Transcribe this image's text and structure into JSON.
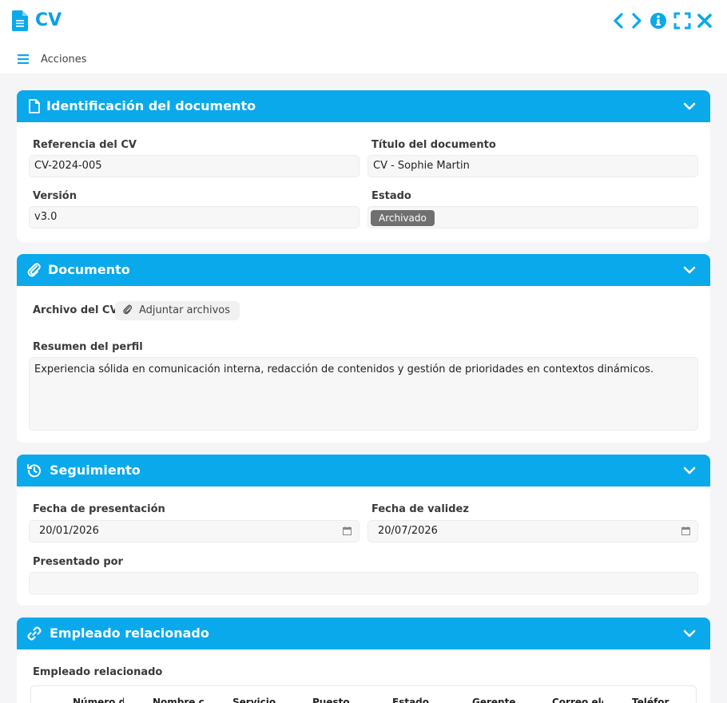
{
  "window": {
    "title": "CV",
    "controls": [
      "chevron-left-icon",
      "chevron-right-icon",
      "info-icon",
      "fullscreen-icon",
      "close-icon"
    ]
  },
  "toolbar": {
    "actions_label": "Acciones"
  },
  "colors": {
    "accent": "#0aa9ec",
    "title": "#0aa0e6",
    "badge": "#707070"
  },
  "sections": {
    "identificacion": {
      "title": "Identificación del documento",
      "referencia_label": "Referencia del CV",
      "referencia_value": "CV-2024-005",
      "titulo_label": "Título del documento",
      "titulo_value": "CV - Sophie Martin",
      "version_label": "Versión",
      "version_value": "v3.0",
      "estado_label": "Estado",
      "estado_value": "Archivado"
    },
    "documento": {
      "title": "Documento",
      "archivo_label": "Archivo del CV",
      "adjuntar_label": "Adjuntar archivos",
      "resumen_label": "Resumen del perfil",
      "resumen_value": "Experiencia sólida en comunicación interna, redacción de contenidos y gestión de prioridades en contextos dinámicos."
    },
    "seguimiento": {
      "title": "Seguimiento",
      "presentacion_label": "Fecha de presentación",
      "presentacion_value": "20/01/2026",
      "validez_label": "Fecha de validez",
      "validez_value": "20/07/2026",
      "presentado_label": "Presentado por",
      "presentado_value": ""
    },
    "empleado": {
      "title": "Empleado relacionado",
      "field_label": "Empleado relacionado",
      "columns": [
        "Número d",
        "Nombre c",
        "Servicio",
        "Puesto",
        "Estado",
        "Gerente",
        "Correo ele",
        "Teléfor"
      ]
    }
  }
}
